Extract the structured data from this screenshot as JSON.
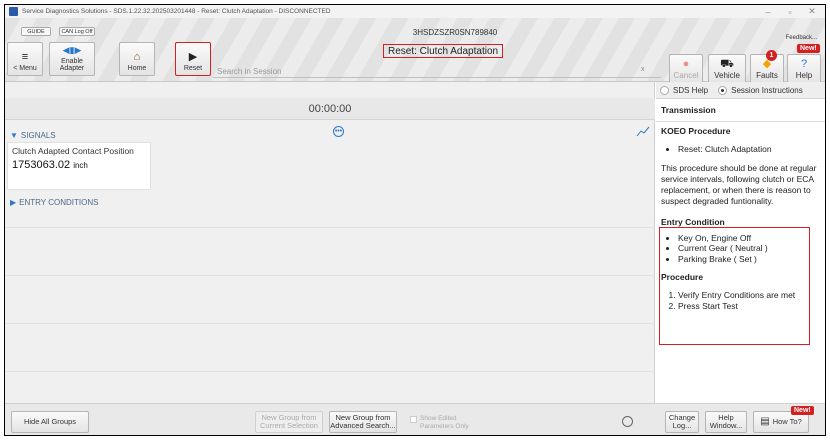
{
  "window": {
    "title": "Service Diagnostics Solutions - SDS.1.22.32.202503201448 - Reset: Clutch Adaptation - DISCONNECTED",
    "controls": [
      "–",
      "▫",
      "✕"
    ]
  },
  "toolbar": {
    "guide_label": "GUIDE",
    "canlog_label": "CAN Log Off",
    "menu_label": "< Menu",
    "enable_adapter_label": "Enable Adapter",
    "home_label": "Home",
    "reset_label": "Reset",
    "vin": "3HSDZSZR0SN789840",
    "page_title": "Reset: Clutch Adaptation",
    "search_placeholder": "Search in Session",
    "search_clear": "x",
    "feedback_label": "Feedback...",
    "cancel_label": "Cancel",
    "vehicle_label": "Vehicle",
    "faults_label": "Faults",
    "faults_count": "1",
    "help_label": "Help",
    "new_badge": "New!"
  },
  "main": {
    "timer": "00:00:00",
    "signals_header": "SIGNALS",
    "signal": {
      "name": "Clutch Adapted Contact Position",
      "value": "1753063.02",
      "unit": "inch"
    },
    "entry_conditions_header": "ENTRY CONDITIONS",
    "more_icon_glyph": "•••"
  },
  "bottom": {
    "hide_groups": "Hide All Groups",
    "new_group_current": "New Group from Current Selection",
    "new_group_advanced": "New Group from Advanced Search...",
    "show_edited": "Show Edited Parameters Only",
    "change_log": "Change Log...",
    "help_window": "Help Window...",
    "how_to": "How To?",
    "new_badge": "New!"
  },
  "panel": {
    "tab_sds_help": "SDS Help",
    "tab_session": "Session Instructions",
    "section": "Transmission",
    "koeo_title": "KOEO Procedure",
    "koeo_items": [
      "Reset: Clutch Adaptation"
    ],
    "description": "This procedure should be done at regular service intervals, following clutch or ECA replacement, or when there is reason to suspect degraded funtionality.",
    "entry_title": "Entry Condition",
    "entry_items": [
      "Key On, Engine Off",
      "Current Gear ( Neutral )",
      "Parking Brake ( Set )"
    ],
    "procedure_title": "Procedure",
    "procedure_steps": [
      "Verify Entry Conditions are met",
      "Press Start Test"
    ]
  },
  "colors": {
    "highlight": "#d42020",
    "accent_blue": "#2b78c9",
    "faults_icon": "#f0a500"
  }
}
